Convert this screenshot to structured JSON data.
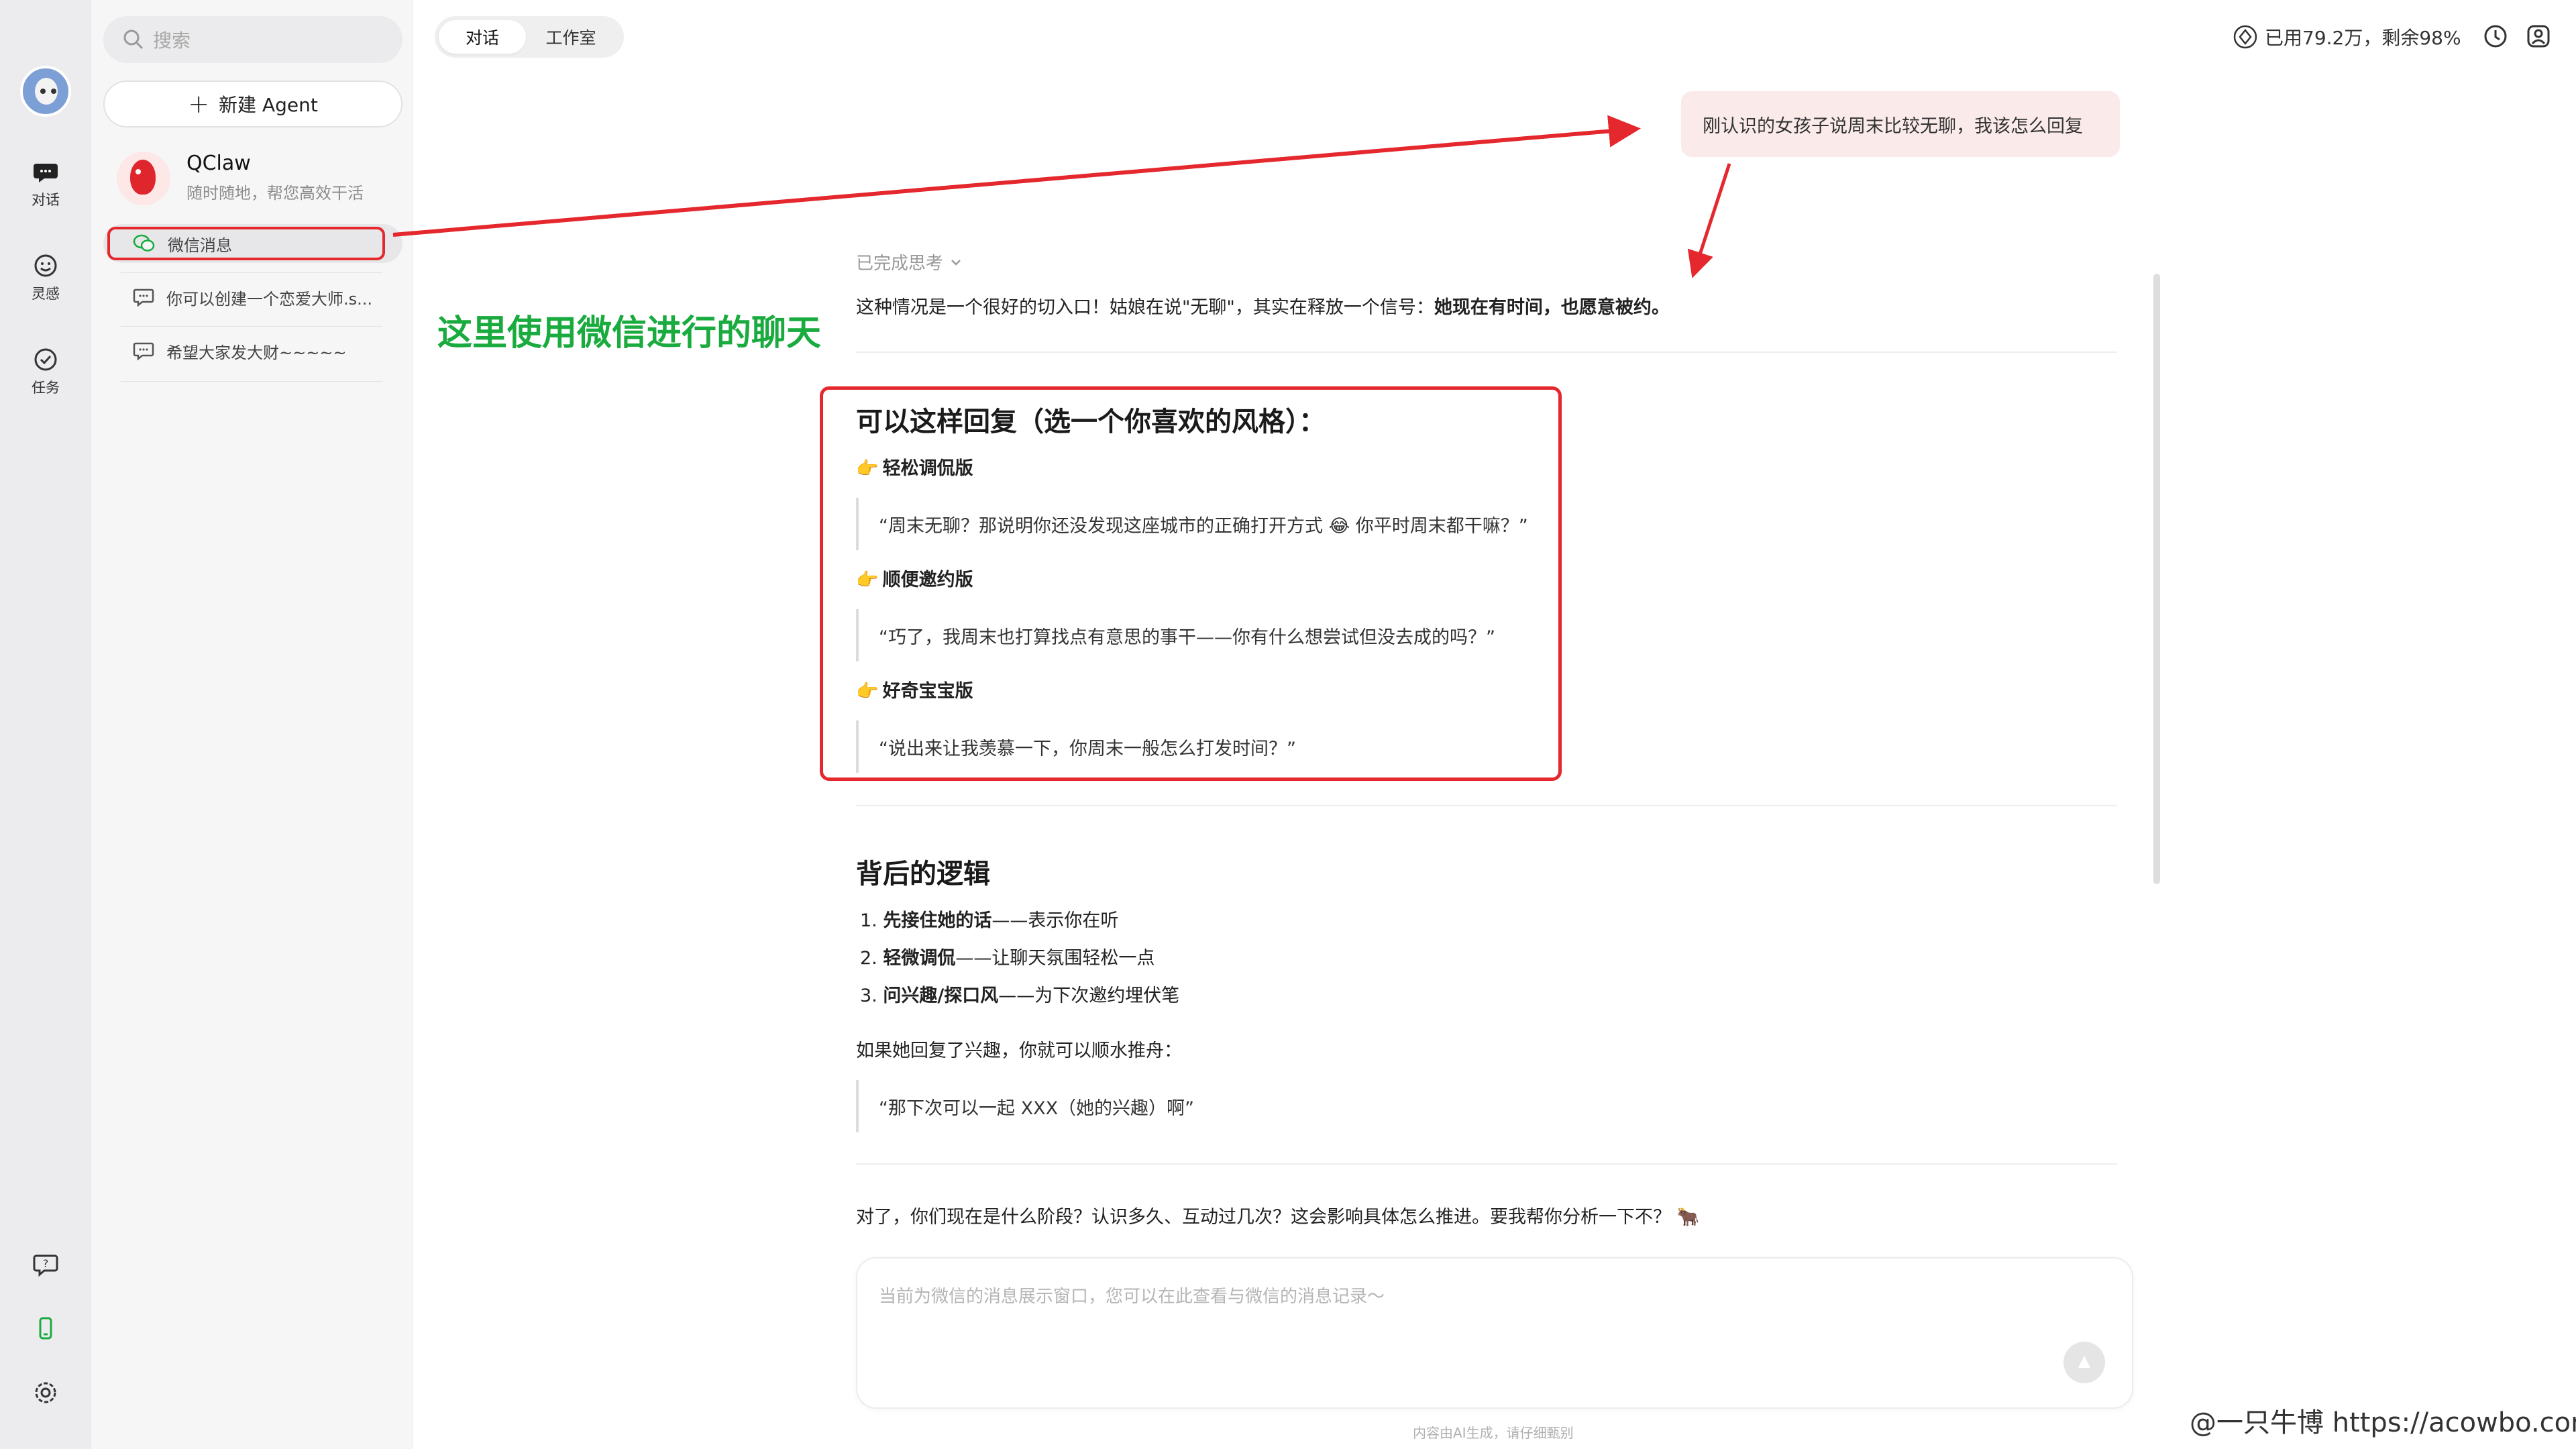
{
  "rail": {
    "items": [
      {
        "label": "对话",
        "icon": "chat-bubble-icon"
      },
      {
        "label": "灵感",
        "icon": "smile-face-icon"
      },
      {
        "label": "任务",
        "icon": "check-circle-icon"
      }
    ],
    "bottom_icons": [
      "help-icon",
      "phone-icon",
      "settings-icon"
    ]
  },
  "sidebar": {
    "search_placeholder": "搜索",
    "new_agent_label": "新建 Agent",
    "agent": {
      "name": "QClaw",
      "subtitle": "随时随地，帮您高效干活"
    },
    "chats": [
      {
        "label": "微信消息",
        "icon": "wechat-icon",
        "active": true
      },
      {
        "label": "你可以创建一个恋爱大师.s...",
        "icon": "chat-icon",
        "active": false
      },
      {
        "label": "希望大家发大财~~~~~",
        "icon": "chat-icon",
        "active": false
      }
    ]
  },
  "header": {
    "tabs": [
      {
        "label": "对话",
        "active": true
      },
      {
        "label": "工作室",
        "active": false
      }
    ],
    "quota": "已用79.2万，剩余98%"
  },
  "conversation": {
    "user_message": "刚认识的女孩子说周末比较无聊，我该怎么回复",
    "thinking_label": "已完成思考",
    "intro_prefix": "这种情况是一个很好的切入口！姑娘在说\"无聊\"，其实在释放一个信号：",
    "intro_bold": "她现在有时间，也愿意被约。",
    "section1_title": "可以这样回复（选一个你喜欢的风格）：",
    "options": [
      {
        "hand": "👉",
        "title": "轻松调侃版",
        "quote": "“周末无聊？那说明你还没发现这座城市的正确打开方式 😂 你平时周末都干嘛？”"
      },
      {
        "hand": "👉",
        "title": "顺便邀约版",
        "quote": "“巧了，我周末也打算找点有意思的事干——你有什么想尝试但没去成的吗？”"
      },
      {
        "hand": "👉",
        "title": "好奇宝宝版",
        "quote": "“说出来让我羡慕一下，你周末一般怎么打发时间？”"
      }
    ],
    "section2_title": "背后的逻辑",
    "logic": [
      {
        "num": "1.",
        "bold": "先接住她的话",
        "rest": "——表示你在听"
      },
      {
        "num": "2.",
        "bold": "轻微调侃",
        "rest": "——让聊天氛围轻松一点"
      },
      {
        "num": "3.",
        "bold": "问兴趣/探口风",
        "rest": "——为下次邀约埋伏笔"
      }
    ],
    "followup": "如果她回复了兴趣，你就可以顺水推舟：",
    "followup_quote": "“那下次可以一起 XXX（她的兴趣）啊”",
    "closing": "对了，你们现在是什么阶段？认识多久、互动过几次？这会影响具体怎么推进。要我帮你分析一下不？ 🐂"
  },
  "input": {
    "placeholder": "当前为微信的消息展示窗口，您可以在此查看与微信的消息记录～"
  },
  "footer": "内容由AI生成，请仔细甄别",
  "annotation": "这里使用微信进行的聊天",
  "watermark": "@一只牛博 https://acowbo.com",
  "colors": {
    "highlight_red": "#e4282e",
    "annotation_green": "#1aab3f",
    "user_bubble": "#fbeaea"
  }
}
